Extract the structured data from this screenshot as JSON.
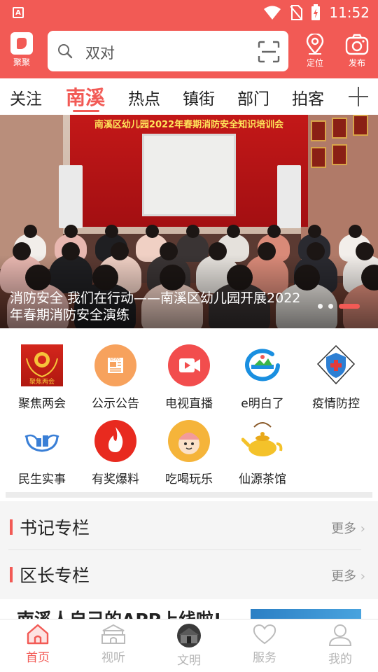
{
  "statusbar": {
    "time": "11:52",
    "app_icon_label": "A"
  },
  "header": {
    "logo_label": "聚聚",
    "search_placeholder": "双对",
    "location_label": "定位",
    "publish_label": "发布"
  },
  "tabs": [
    {
      "label": "关注"
    },
    {
      "label": "南溪",
      "active": true
    },
    {
      "label": "热点"
    },
    {
      "label": "镇街"
    },
    {
      "label": "部门"
    },
    {
      "label": "拍客"
    }
  ],
  "banner": {
    "photo_title": "南溪区幼儿园2022年春期消防安全知识培训会",
    "caption": "消防安全 我们在行动——南溪区幼儿园开展2022年春期消防安全演练",
    "slide_count": 3,
    "active_slide": 3
  },
  "grid": [
    {
      "label": "聚焦两会",
      "icon": "two-sessions-icon"
    },
    {
      "label": "公示公告",
      "icon": "notice-icon"
    },
    {
      "label": "电视直播",
      "icon": "tv-live-icon"
    },
    {
      "label": "e明白了",
      "icon": "e-mingbai-icon"
    },
    {
      "label": "疫情防控",
      "icon": "epidemic-shield-icon"
    },
    {
      "label": "民生实事",
      "icon": "livelihood-hands-icon"
    },
    {
      "label": "有奖爆料",
      "icon": "flame-icon"
    },
    {
      "label": "吃喝玩乐",
      "icon": "food-fun-icon"
    },
    {
      "label": "仙源茶馆",
      "icon": "teapot-icon"
    }
  ],
  "grid_icon_text": {
    "two_sessions": "聚焦两会",
    "notice": "NEWS"
  },
  "columns": [
    {
      "title": "书记专栏",
      "more": "更多"
    },
    {
      "title": "区长专栏",
      "more": "更多"
    }
  ],
  "news_peek": "南溪人自己的APP上线啦!",
  "bottom_nav": [
    {
      "label": "首页",
      "active": true
    },
    {
      "label": "视听"
    },
    {
      "label": "文明"
    },
    {
      "label": "服务"
    },
    {
      "label": "我的"
    }
  ],
  "colors": {
    "accent": "#f25a55",
    "inactive": "#b5b5b5"
  }
}
